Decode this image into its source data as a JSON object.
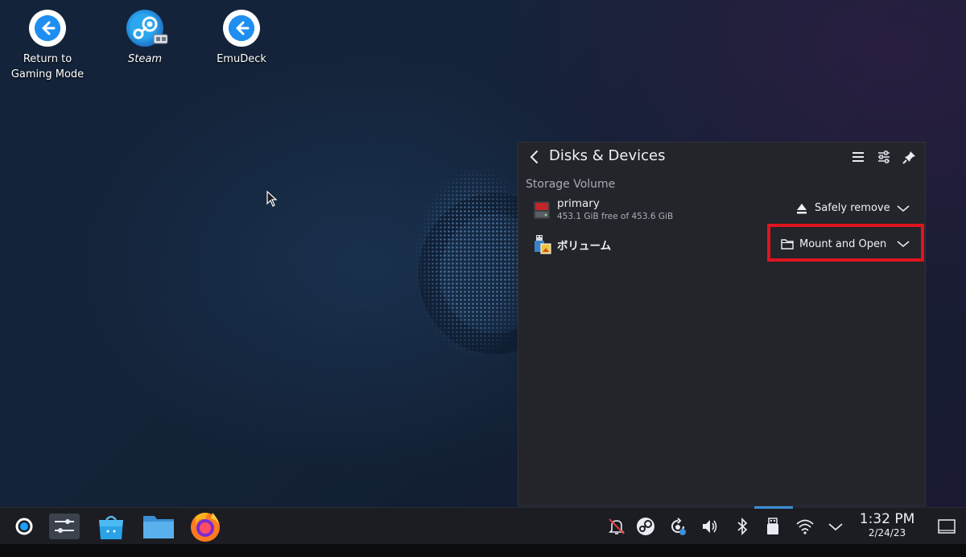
{
  "desktop": {
    "icons": [
      {
        "label": "Return to\nGaming Mode",
        "icon": "return-arrow-icon"
      },
      {
        "label": "Steam",
        "icon": "steam-icon"
      },
      {
        "label": "EmuDeck",
        "icon": "return-arrow-icon"
      }
    ]
  },
  "panel": {
    "title": "Disks & Devices",
    "section_label": "Storage Volume",
    "devices": [
      {
        "name": "primary",
        "detail": "453.1 GiB free of 453.6 GiB",
        "icon": "hard-drive-icon",
        "action_label": "Safely remove",
        "action_icon": "eject-icon"
      },
      {
        "name": "ボリューム",
        "icon": "usb-volume-icon",
        "action_label": "Mount and Open",
        "action_icon": "folder-icon"
      }
    ],
    "header_buttons": [
      "menu-icon",
      "settings-sliders-icon",
      "pin-icon"
    ]
  },
  "taskbar": {
    "launchers": [
      "steam-deck-logo-icon",
      "system-settings-icon",
      "discover-store-icon",
      "file-manager-icon",
      "firefox-icon"
    ],
    "tray": [
      "notifications-muted-icon",
      "steam-tray-icon",
      "update-icon",
      "volume-icon",
      "bluetooth-icon",
      "usb-device-icon",
      "wifi-icon",
      "expand-tray-icon"
    ],
    "clock": {
      "time": "1:32 PM",
      "date": "2/24/23"
    }
  },
  "colors": {
    "accent": "#3d8fd6",
    "highlight": "#e0141f",
    "panel_bg": "#23252b",
    "taskbar_bg": "#1b1d22"
  }
}
